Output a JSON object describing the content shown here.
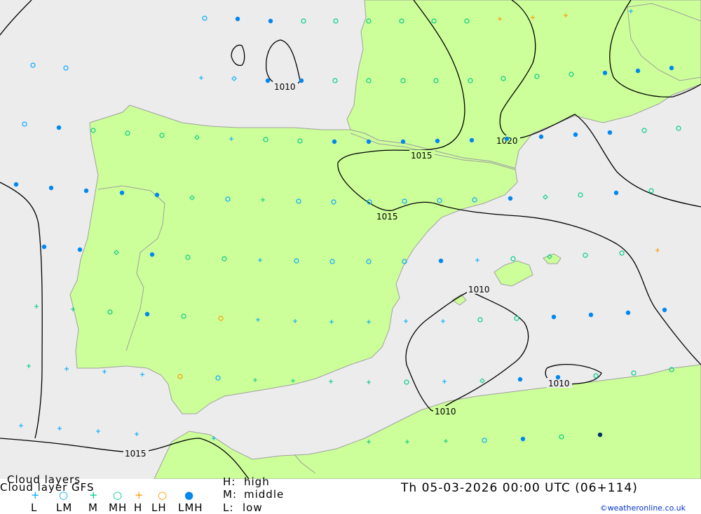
{
  "header": {
    "title_line1": "Cloud layers",
    "title_line2": "Cloud layer   GFS",
    "datetime": "Th 05-03-2026 00:00 UTC (06+114)",
    "credit": "©weatheronline.co.uk"
  },
  "legend": {
    "symbols": [
      {
        "glyph": "+",
        "label": "L",
        "color": "#00aaff"
      },
      {
        "glyph": "○",
        "label": "LM",
        "color": "#00aaff"
      },
      {
        "glyph": "+",
        "label": "M",
        "color": "#00cc88"
      },
      {
        "glyph": "○",
        "label": "MH",
        "color": "#00cc88"
      },
      {
        "glyph": "+",
        "label": "H",
        "color": "#ff9900"
      },
      {
        "glyph": "○",
        "label": "LH",
        "color": "#ff9900"
      },
      {
        "glyph": "●",
        "label": "LMH",
        "color": "#0088ee"
      }
    ],
    "key": [
      {
        "code": "H:",
        "desc": "high"
      },
      {
        "code": "M:",
        "desc": "middle"
      },
      {
        "code": "L:",
        "desc": "low"
      }
    ]
  },
  "isobar_labels": [
    "1010",
    "1015",
    "1020",
    "1015",
    "1010",
    "1010",
    "1010",
    "1015"
  ],
  "colors": {
    "land": "#ccff99",
    "sea": "#ececec",
    "coast": "#a0a0a0",
    "isobar": "#000000"
  }
}
